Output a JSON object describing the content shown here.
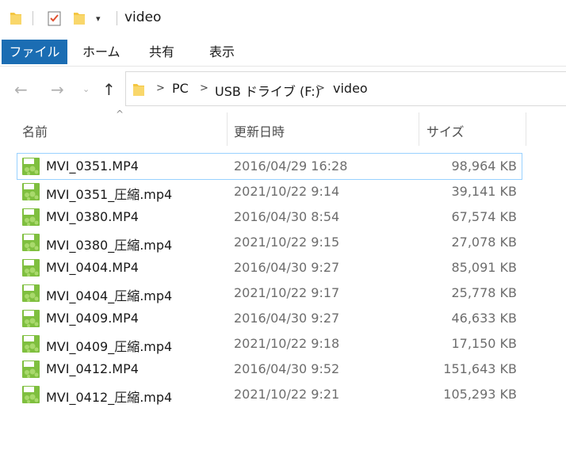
{
  "titlebar": {
    "title": "video",
    "dropdown_glyph": "▾"
  },
  "ribbon": {
    "tabs": [
      {
        "label": "ファイル",
        "active": true
      },
      {
        "label": "ホーム"
      },
      {
        "label": "共有"
      },
      {
        "label": "表示"
      }
    ]
  },
  "nav": {
    "breadcrumb": [
      "PC",
      "USB ドライブ (F:)",
      "video"
    ]
  },
  "columns": {
    "name": "名前",
    "date": "更新日時",
    "size": "サイズ"
  },
  "colors": {
    "accent": "#1b6db3",
    "selection_outline": "#99d1ff",
    "mp4_icon": "#7fbf3f"
  },
  "files": [
    {
      "name": "MVI_0351.MP4",
      "date": "2016/04/29 16:28",
      "size": "98,964 KB",
      "icon": "mp4-file-icon"
    },
    {
      "name": "MVI_0351_圧縮.mp4",
      "date": "2021/10/22 9:14",
      "size": "39,141 KB",
      "icon": "mp4-file-icon"
    },
    {
      "name": "MVI_0380.MP4",
      "date": "2016/04/30 8:54",
      "size": "67,574 KB",
      "icon": "mp4-file-icon"
    },
    {
      "name": "MVI_0380_圧縮.mp4",
      "date": "2021/10/22 9:15",
      "size": "27,078 KB",
      "icon": "mp4-file-icon"
    },
    {
      "name": "MVI_0404.MP4",
      "date": "2016/04/30 9:27",
      "size": "85,091 KB",
      "icon": "mp4-file-icon"
    },
    {
      "name": "MVI_0404_圧縮.mp4",
      "date": "2021/10/22 9:17",
      "size": "25,778 KB",
      "icon": "mp4-file-icon"
    },
    {
      "name": "MVI_0409.MP4",
      "date": "2016/04/30 9:27",
      "size": "46,633 KB",
      "icon": "mp4-file-icon"
    },
    {
      "name": "MVI_0409_圧縮.mp4",
      "date": "2021/10/22 9:18",
      "size": "17,150 KB",
      "icon": "mp4-file-icon"
    },
    {
      "name": "MVI_0412.MP4",
      "date": "2016/04/30 9:52",
      "size": "151,643 KB",
      "icon": "mp4-file-icon"
    },
    {
      "name": "MVI_0412_圧縮.mp4",
      "date": "2021/10/22 9:21",
      "size": "105,293 KB",
      "icon": "mp4-file-icon"
    }
  ]
}
